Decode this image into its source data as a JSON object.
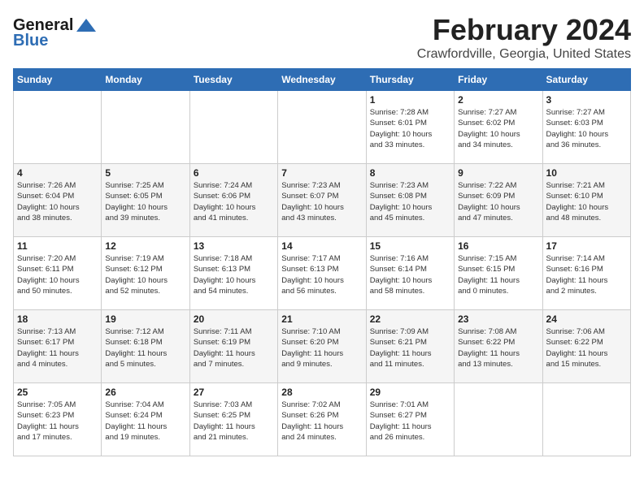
{
  "logo": {
    "general": "General",
    "blue": "Blue"
  },
  "header": {
    "title": "February 2024",
    "subtitle": "Crawfordville, Georgia, United States"
  },
  "days_of_week": [
    "Sunday",
    "Monday",
    "Tuesday",
    "Wednesday",
    "Thursday",
    "Friday",
    "Saturday"
  ],
  "weeks": [
    [
      {
        "day": "",
        "info": ""
      },
      {
        "day": "",
        "info": ""
      },
      {
        "day": "",
        "info": ""
      },
      {
        "day": "",
        "info": ""
      },
      {
        "day": "1",
        "info": "Sunrise: 7:28 AM\nSunset: 6:01 PM\nDaylight: 10 hours\nand 33 minutes."
      },
      {
        "day": "2",
        "info": "Sunrise: 7:27 AM\nSunset: 6:02 PM\nDaylight: 10 hours\nand 34 minutes."
      },
      {
        "day": "3",
        "info": "Sunrise: 7:27 AM\nSunset: 6:03 PM\nDaylight: 10 hours\nand 36 minutes."
      }
    ],
    [
      {
        "day": "4",
        "info": "Sunrise: 7:26 AM\nSunset: 6:04 PM\nDaylight: 10 hours\nand 38 minutes."
      },
      {
        "day": "5",
        "info": "Sunrise: 7:25 AM\nSunset: 6:05 PM\nDaylight: 10 hours\nand 39 minutes."
      },
      {
        "day": "6",
        "info": "Sunrise: 7:24 AM\nSunset: 6:06 PM\nDaylight: 10 hours\nand 41 minutes."
      },
      {
        "day": "7",
        "info": "Sunrise: 7:23 AM\nSunset: 6:07 PM\nDaylight: 10 hours\nand 43 minutes."
      },
      {
        "day": "8",
        "info": "Sunrise: 7:23 AM\nSunset: 6:08 PM\nDaylight: 10 hours\nand 45 minutes."
      },
      {
        "day": "9",
        "info": "Sunrise: 7:22 AM\nSunset: 6:09 PM\nDaylight: 10 hours\nand 47 minutes."
      },
      {
        "day": "10",
        "info": "Sunrise: 7:21 AM\nSunset: 6:10 PM\nDaylight: 10 hours\nand 48 minutes."
      }
    ],
    [
      {
        "day": "11",
        "info": "Sunrise: 7:20 AM\nSunset: 6:11 PM\nDaylight: 10 hours\nand 50 minutes."
      },
      {
        "day": "12",
        "info": "Sunrise: 7:19 AM\nSunset: 6:12 PM\nDaylight: 10 hours\nand 52 minutes."
      },
      {
        "day": "13",
        "info": "Sunrise: 7:18 AM\nSunset: 6:13 PM\nDaylight: 10 hours\nand 54 minutes."
      },
      {
        "day": "14",
        "info": "Sunrise: 7:17 AM\nSunset: 6:13 PM\nDaylight: 10 hours\nand 56 minutes."
      },
      {
        "day": "15",
        "info": "Sunrise: 7:16 AM\nSunset: 6:14 PM\nDaylight: 10 hours\nand 58 minutes."
      },
      {
        "day": "16",
        "info": "Sunrise: 7:15 AM\nSunset: 6:15 PM\nDaylight: 11 hours\nand 0 minutes."
      },
      {
        "day": "17",
        "info": "Sunrise: 7:14 AM\nSunset: 6:16 PM\nDaylight: 11 hours\nand 2 minutes."
      }
    ],
    [
      {
        "day": "18",
        "info": "Sunrise: 7:13 AM\nSunset: 6:17 PM\nDaylight: 11 hours\nand 4 minutes."
      },
      {
        "day": "19",
        "info": "Sunrise: 7:12 AM\nSunset: 6:18 PM\nDaylight: 11 hours\nand 5 minutes."
      },
      {
        "day": "20",
        "info": "Sunrise: 7:11 AM\nSunset: 6:19 PM\nDaylight: 11 hours\nand 7 minutes."
      },
      {
        "day": "21",
        "info": "Sunrise: 7:10 AM\nSunset: 6:20 PM\nDaylight: 11 hours\nand 9 minutes."
      },
      {
        "day": "22",
        "info": "Sunrise: 7:09 AM\nSunset: 6:21 PM\nDaylight: 11 hours\nand 11 minutes."
      },
      {
        "day": "23",
        "info": "Sunrise: 7:08 AM\nSunset: 6:22 PM\nDaylight: 11 hours\nand 13 minutes."
      },
      {
        "day": "24",
        "info": "Sunrise: 7:06 AM\nSunset: 6:22 PM\nDaylight: 11 hours\nand 15 minutes."
      }
    ],
    [
      {
        "day": "25",
        "info": "Sunrise: 7:05 AM\nSunset: 6:23 PM\nDaylight: 11 hours\nand 17 minutes."
      },
      {
        "day": "26",
        "info": "Sunrise: 7:04 AM\nSunset: 6:24 PM\nDaylight: 11 hours\nand 19 minutes."
      },
      {
        "day": "27",
        "info": "Sunrise: 7:03 AM\nSunset: 6:25 PM\nDaylight: 11 hours\nand 21 minutes."
      },
      {
        "day": "28",
        "info": "Sunrise: 7:02 AM\nSunset: 6:26 PM\nDaylight: 11 hours\nand 24 minutes."
      },
      {
        "day": "29",
        "info": "Sunrise: 7:01 AM\nSunset: 6:27 PM\nDaylight: 11 hours\nand 26 minutes."
      },
      {
        "day": "",
        "info": ""
      },
      {
        "day": "",
        "info": ""
      }
    ]
  ]
}
